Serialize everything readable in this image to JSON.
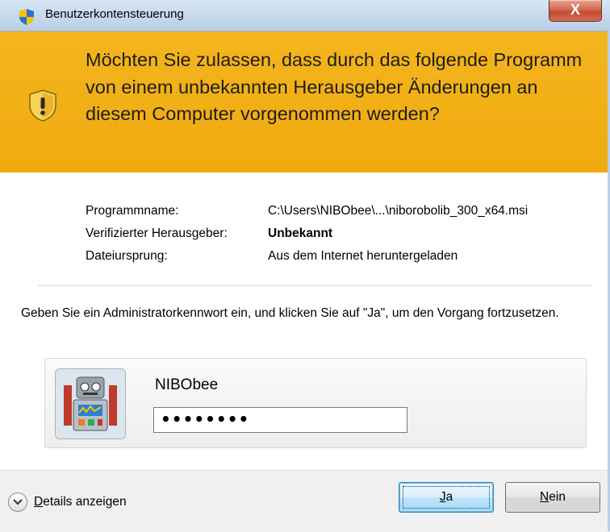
{
  "window": {
    "title": "Benutzerkontensteuerung",
    "close_label": "X"
  },
  "banner": {
    "message": "Möchten Sie zulassen, dass durch das folgende Programm von einem unbekannten Herausgeber Änderungen an diesem Computer vorgenommen werden?",
    "color": "#f2ae16"
  },
  "info": [
    {
      "label": "Programmname:",
      "value": "C:\\Users\\NIBObee\\...\\niborobolib_300_x64.msi",
      "bold": false
    },
    {
      "label": "Verifizierter Herausgeber:",
      "value": "Unbekannt",
      "bold": true
    },
    {
      "label": "Dateiursprung:",
      "value": "Aus dem Internet heruntergeladen",
      "bold": false
    }
  ],
  "instruction": "Geben Sie ein Administratorkennwort ein, und klicken Sie auf \"Ja\", um den Vorgang fortzusetzen.",
  "credential": {
    "username": "NIBObee",
    "password_masked": "••••••••",
    "avatar_icon": "robot-avatar"
  },
  "footer": {
    "details_label": "Details anzeigen",
    "yes_label": "Ja",
    "no_label": "Nein"
  }
}
